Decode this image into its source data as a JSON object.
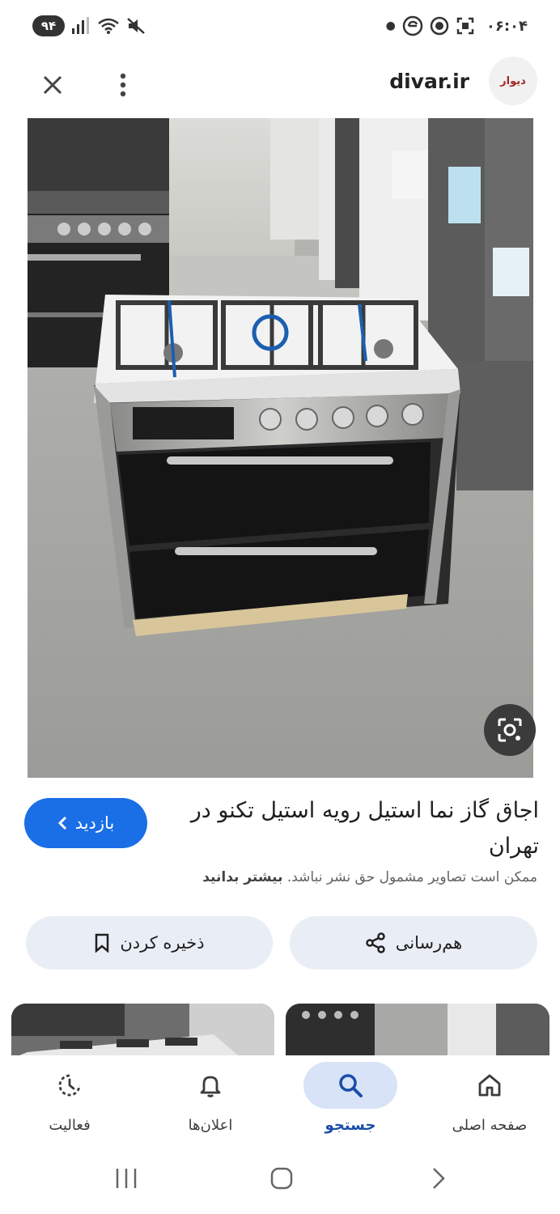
{
  "status_bar": {
    "battery": "۹۴",
    "time": "۰۶:۰۴"
  },
  "app_bar": {
    "url": "divar.ir",
    "logo_text": "دیوار"
  },
  "result": {
    "title": "اجاق گاز نما استیل رویه استیل تکنو در تهران",
    "copyright_notice": "ممکن است تصاویر مشمول حق نشر نباشد.",
    "learn_more": "بیشتر بدانید",
    "visit_label": "بازدید"
  },
  "actions": {
    "share_label": "هم‌رسانی",
    "save_label": "ذخیره کردن"
  },
  "bottom_nav": {
    "items": [
      {
        "label": "صفحه اصلی",
        "icon": "home-icon",
        "active": false
      },
      {
        "label": "جستجو",
        "icon": "search-icon",
        "active": true
      },
      {
        "label": "اعلان‌ها",
        "icon": "bell-icon",
        "active": false
      },
      {
        "label": "فعالیت",
        "icon": "activity-icon",
        "active": false
      }
    ]
  },
  "colors": {
    "accent": "#1a6ee6",
    "pill_bg": "#e9eef6",
    "active_nav_bg": "#d8e3f7"
  }
}
